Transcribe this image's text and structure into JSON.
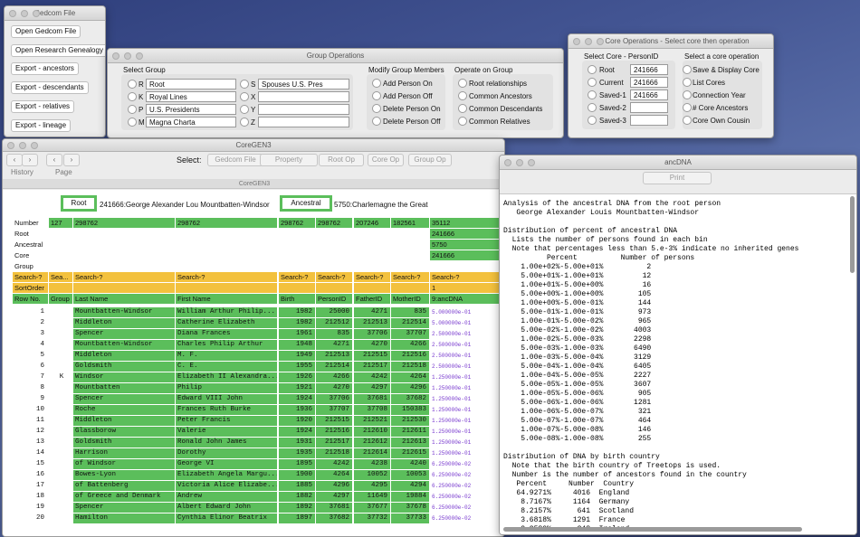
{
  "gedcom": {
    "title": "Gedcom File",
    "buttons": [
      "Open Gedcom File",
      "Open Research Genealogy",
      "Export - ancestors",
      "Export - descendants",
      "Export - relatives",
      "Export - lineage"
    ]
  },
  "group_ops": {
    "title": "Group Operations",
    "select_label": "Select Group",
    "groups_left": [
      {
        "key": "R",
        "value": "Root"
      },
      {
        "key": "K",
        "value": "Royal Lines"
      },
      {
        "key": "P",
        "value": "U.S. Presidents"
      },
      {
        "key": "M",
        "value": "Magna Charta"
      }
    ],
    "groups_right": [
      {
        "key": "S",
        "value": "Spouses U.S. Pres"
      },
      {
        "key": "X",
        "value": ""
      },
      {
        "key": "Y",
        "value": ""
      },
      {
        "key": "Z",
        "value": ""
      }
    ],
    "modify_label": "Modify Group Members",
    "modify": [
      "Add Person On",
      "Add Person Off",
      "Delete Person On",
      "Delete Person Off"
    ],
    "operate_label": "Operate on Group",
    "operate": [
      "Root relationships",
      "Common Ancestors",
      "Common Descendants",
      "Common Relatives"
    ]
  },
  "core_ops": {
    "title": "Core Operations - Select core then operation",
    "select_label": "Select Core - PersonID",
    "cores": [
      {
        "name": "Root",
        "value": "241666"
      },
      {
        "name": "Current",
        "value": "241666"
      },
      {
        "name": "Saved-1",
        "value": "241666"
      },
      {
        "name": "Saved-2",
        "value": ""
      },
      {
        "name": "Saved-3",
        "value": ""
      }
    ],
    "op_label": "Select a core operation",
    "ops": [
      "Save & Display Core",
      "List Cores",
      "Connection Year",
      "# Core Ancestors",
      "Core Own Cousin"
    ]
  },
  "coregen": {
    "title": "CoreGEN3",
    "history": "History",
    "page": "Page",
    "select_label": "Select:",
    "toolbar": [
      "Gedcom File",
      "Property",
      "Root Op",
      "Core Op",
      "Group Op"
    ],
    "subtitle": "CoreGEN3",
    "root_btn": "Root",
    "root_value": "241666:George Alexander Lou Mountbatten-Windsor",
    "anc_btn": "Ancestral",
    "anc_value": "5750:Charlemagne the Great",
    "summary_labels": [
      "Number",
      "Root",
      "Ancestral",
      "Core",
      "Group"
    ],
    "summary_number": [
      "127",
      "298762",
      "298762",
      "298762",
      "298762",
      "207246",
      "182561",
      "35112"
    ],
    "summary_last": [
      "241666",
      "5750",
      "241666"
    ],
    "search_labels": [
      "Search-?",
      "Sea...",
      "Search-?",
      "Search-?",
      "Search-?",
      "Search-?",
      "Search-?",
      "Search-?",
      "Search-?"
    ],
    "sortorder_label": "SortOrder",
    "sortorder_value": "1",
    "headers": [
      "Row No.",
      "Group",
      "Last Name",
      "First Name",
      "Birth",
      "PersonID",
      "FatherID",
      "MotherID",
      "9:ancDNA"
    ],
    "rows": [
      [
        "1",
        "",
        "Mountbatten-Windsor",
        "William Arthur Philip...",
        "1982",
        "25000",
        "4271",
        "835",
        "5.000000e-01"
      ],
      [
        "2",
        "",
        "Middleton",
        "Catherine Elizabeth",
        "1982",
        "212512",
        "212513",
        "212514",
        "5.000000e-01"
      ],
      [
        "3",
        "",
        "Spencer",
        "Diana Frances",
        "1961",
        "835",
        "37706",
        "37707",
        "2.500000e-01"
      ],
      [
        "4",
        "",
        "Mountbatten-Windsor",
        "Charles Philip Arthur",
        "1948",
        "4271",
        "4270",
        "4266",
        "2.500000e-01"
      ],
      [
        "5",
        "",
        "Middleton",
        "M. F.",
        "1949",
        "212513",
        "212515",
        "212516",
        "2.500000e-01"
      ],
      [
        "6",
        "",
        "Goldsmith",
        "C. E.",
        "1955",
        "212514",
        "212517",
        "212518",
        "2.500000e-01"
      ],
      [
        "7",
        "K",
        "Windsor",
        "Elizabeth II Alexandra...",
        "1926",
        "4266",
        "4242",
        "4264",
        "1.250000e-01"
      ],
      [
        "8",
        "",
        "Mountbatten",
        "Philip",
        "1921",
        "4270",
        "4297",
        "4296",
        "1.250000e-01"
      ],
      [
        "9",
        "",
        "Spencer",
        "Edward VIII John",
        "1924",
        "37706",
        "37681",
        "37682",
        "1.250000e-01"
      ],
      [
        "10",
        "",
        "Roche",
        "Frances Ruth Burke",
        "1936",
        "37707",
        "37708",
        "150383",
        "1.250000e-01"
      ],
      [
        "11",
        "",
        "Middleton",
        "Peter Francis",
        "1920",
        "212515",
        "212521",
        "212530",
        "1.250000e-01"
      ],
      [
        "12",
        "",
        "Glassborow",
        "Valerie",
        "1924",
        "212516",
        "212610",
        "212611",
        "1.250000e-01"
      ],
      [
        "13",
        "",
        "Goldsmith",
        "Ronald John James",
        "1931",
        "212517",
        "212612",
        "212613",
        "1.250000e-01"
      ],
      [
        "14",
        "",
        "Harrison",
        "Dorothy",
        "1935",
        "212518",
        "212614",
        "212615",
        "1.250000e-01"
      ],
      [
        "15",
        "",
        "of Windsor",
        "George VI",
        "1895",
        "4242",
        "4238",
        "4240",
        "6.250000e-02"
      ],
      [
        "16",
        "",
        "Bowes-Lyon",
        "Elizabeth Angela Margu...",
        "1900",
        "4264",
        "10052",
        "10053",
        "6.250000e-02"
      ],
      [
        "17",
        "",
        "of Battenberg",
        "Victoria Alice Elizabe...",
        "1885",
        "4296",
        "4295",
        "4294",
        "6.250000e-02"
      ],
      [
        "18",
        "",
        "of Greece and Denmark",
        "Andrew",
        "1882",
        "4297",
        "11649",
        "19884",
        "6.250000e-02"
      ],
      [
        "19",
        "",
        "Spencer",
        "Albert Edward John",
        "1892",
        "37681",
        "37677",
        "37678",
        "6.250000e-02"
      ],
      [
        "20",
        "",
        "Hamilton",
        "Cynthia Elinor Beatrix",
        "1897",
        "37682",
        "37732",
        "37733",
        "6.250000e-02"
      ]
    ]
  },
  "ancdna": {
    "title": "ancDNA",
    "print": "Print",
    "lines": [
      "Analysis of the ancestral DNA from the root person",
      "   George Alexander Louis Mountbatten-Windsor",
      "",
      "Distribution of percent of ancestral DNA",
      "  Lists the number of persons found in each bin",
      "  Note that percentages less than 5.e-3% indicate no inherited genes",
      "          Percent          Number of persons",
      "    1.00e+02%-5.00e+01%          2",
      "    5.00e+01%-1.00e+01%         12",
      "    1.00e+01%-5.00e+00%         16",
      "    5.00e+00%-1.00e+00%        105",
      "    1.00e+00%-5.00e-01%        144",
      "    5.00e-01%-1.00e-01%        973",
      "    1.00e-01%-5.00e-02%        965",
      "    5.00e-02%-1.00e-02%       4003",
      "    1.00e-02%-5.00e-03%       2298",
      "    5.00e-03%-1.00e-03%       6490",
      "    1.00e-03%-5.00e-04%       3129",
      "    5.00e-04%-1.00e-04%       6405",
      "    1.00e-04%-5.00e-05%       2227",
      "    5.00e-05%-1.00e-05%       3607",
      "    1.00e-05%-5.00e-06%        905",
      "    5.00e-06%-1.00e-06%       1281",
      "    1.00e-06%-5.00e-07%        321",
      "    5.00e-07%-1.00e-07%        464",
      "    1.00e-07%-5.00e-08%        146",
      "    5.00e-08%-1.00e-08%        255",
      "",
      "Distribution of DNA by birth country",
      "  Note that the birth country of Treetops is used.",
      "  Number is the number of ancestors found in the country",
      "   Percent     Number  Country",
      "   64.9271%     4016  England",
      "    8.7167%     1164  Germany",
      "    8.2157%      641  Scotland",
      "    3.6818%     1291  France",
      "    3.2580%      248  Ireland"
    ]
  }
}
